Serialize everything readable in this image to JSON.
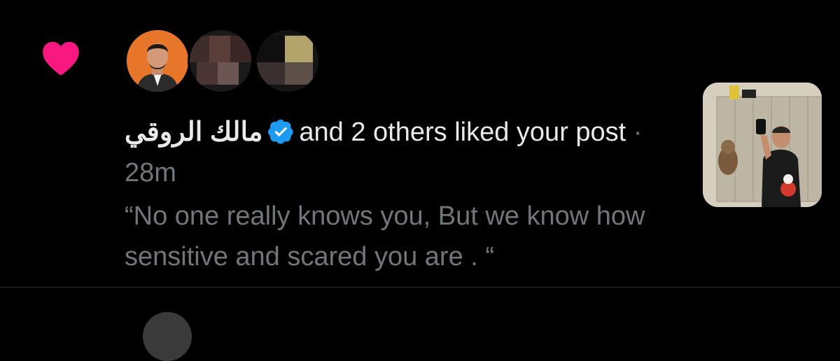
{
  "notification": {
    "icon": "heart-icon",
    "icon_color": "#f91880",
    "actor_name": "مالك الروقي",
    "verified_icon": "verified-badge-icon",
    "verified_color": "#1d9bf0",
    "action_text": "and 2 others liked your post",
    "separator": "·",
    "time": "28m",
    "post_excerpt": "“No one really knows you, But we know how sensitive and scared you are . “"
  }
}
